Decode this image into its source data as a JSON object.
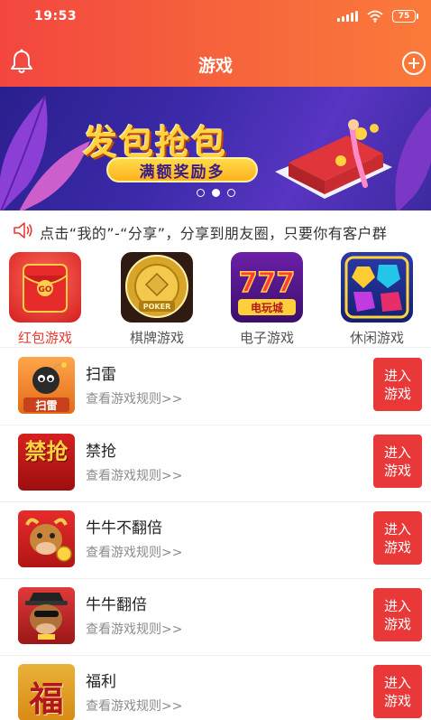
{
  "status_bar": {
    "time": "19:53",
    "battery": "75"
  },
  "nav": {
    "title": "游戏"
  },
  "banner": {
    "title": "发包抢包",
    "subtitle": "满额奖励多",
    "slide_count": 3,
    "active_slide": 2
  },
  "announcement": {
    "text": "点击“我的”-“分享”，分享到朋友圈，只要你有客户群"
  },
  "categories": [
    {
      "label": "红包游戏",
      "active": true,
      "icon": "red-packet-icon"
    },
    {
      "label": "棋牌游戏",
      "active": false,
      "icon": "poker-chip-icon"
    },
    {
      "label": "电子游戏",
      "active": false,
      "icon": "slot-machine-icon"
    },
    {
      "label": "休闲游戏",
      "active": false,
      "icon": "gems-icon"
    }
  ],
  "games": [
    {
      "name": "扫雷",
      "rules_link": "查看游戏规则>>",
      "enter_label_line1": "进入",
      "enter_label_line2": "游戏",
      "thumb_text": "扫雷",
      "icon": "bomb-icon"
    },
    {
      "name": "禁抢",
      "rules_link": "查看游戏规则>>",
      "enter_label_line1": "进入",
      "enter_label_line2": "游戏",
      "thumb_text": "禁抢",
      "icon": "forbid-text-icon"
    },
    {
      "name": "牛牛不翻倍",
      "rules_link": "查看游戏规则>>",
      "enter_label_line1": "进入",
      "enter_label_line2": "游戏",
      "thumb_text": "",
      "icon": "bull-icon"
    },
    {
      "name": "牛牛翻倍",
      "rules_link": "查看游戏规则>>",
      "enter_label_line1": "进入",
      "enter_label_line2": "游戏",
      "thumb_text": "",
      "icon": "bull-hat-icon"
    },
    {
      "name": "福利",
      "rules_link": "查看游戏规则>>",
      "enter_label_line1": "进入",
      "enter_label_line2": "游戏",
      "thumb_text": "福",
      "icon": "fu-character-icon"
    }
  ],
  "colors": {
    "header_start": "#f3463f",
    "header_end": "#fb7a3a",
    "accent": "#e93838",
    "active_category": "#e73b34"
  }
}
